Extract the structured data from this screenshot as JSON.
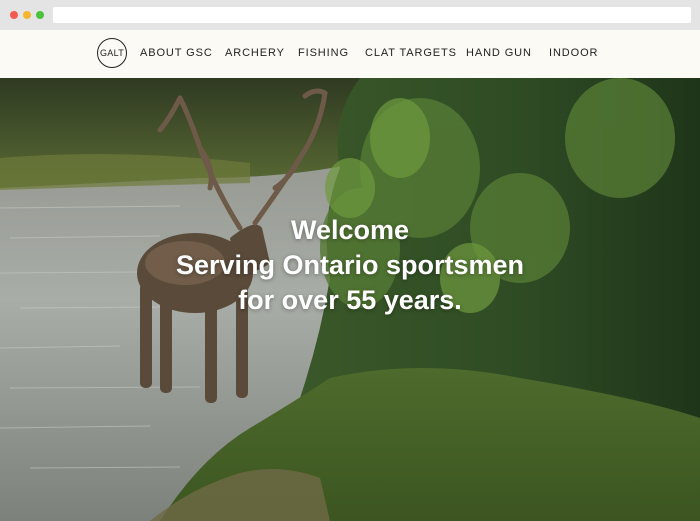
{
  "browser": {
    "url": ""
  },
  "nav": {
    "logo_text": "GALT",
    "items": [
      {
        "label": "ABOUT GSC"
      },
      {
        "label": "ARCHERY"
      },
      {
        "label": "FISHING"
      },
      {
        "label": "CLAT TARGETS"
      },
      {
        "label": "HAND GUN"
      },
      {
        "label": "INDOOR"
      }
    ]
  },
  "hero": {
    "line1": "Welcome",
    "line2": "Serving Ontario sportsmen",
    "line3": "for over 55 years.",
    "background_image": "caribou-in-river-photo"
  },
  "colors": {
    "nav_background": "#fbfaf5",
    "hero_text": "#ffffff",
    "chrome": "#e4e4e4"
  }
}
